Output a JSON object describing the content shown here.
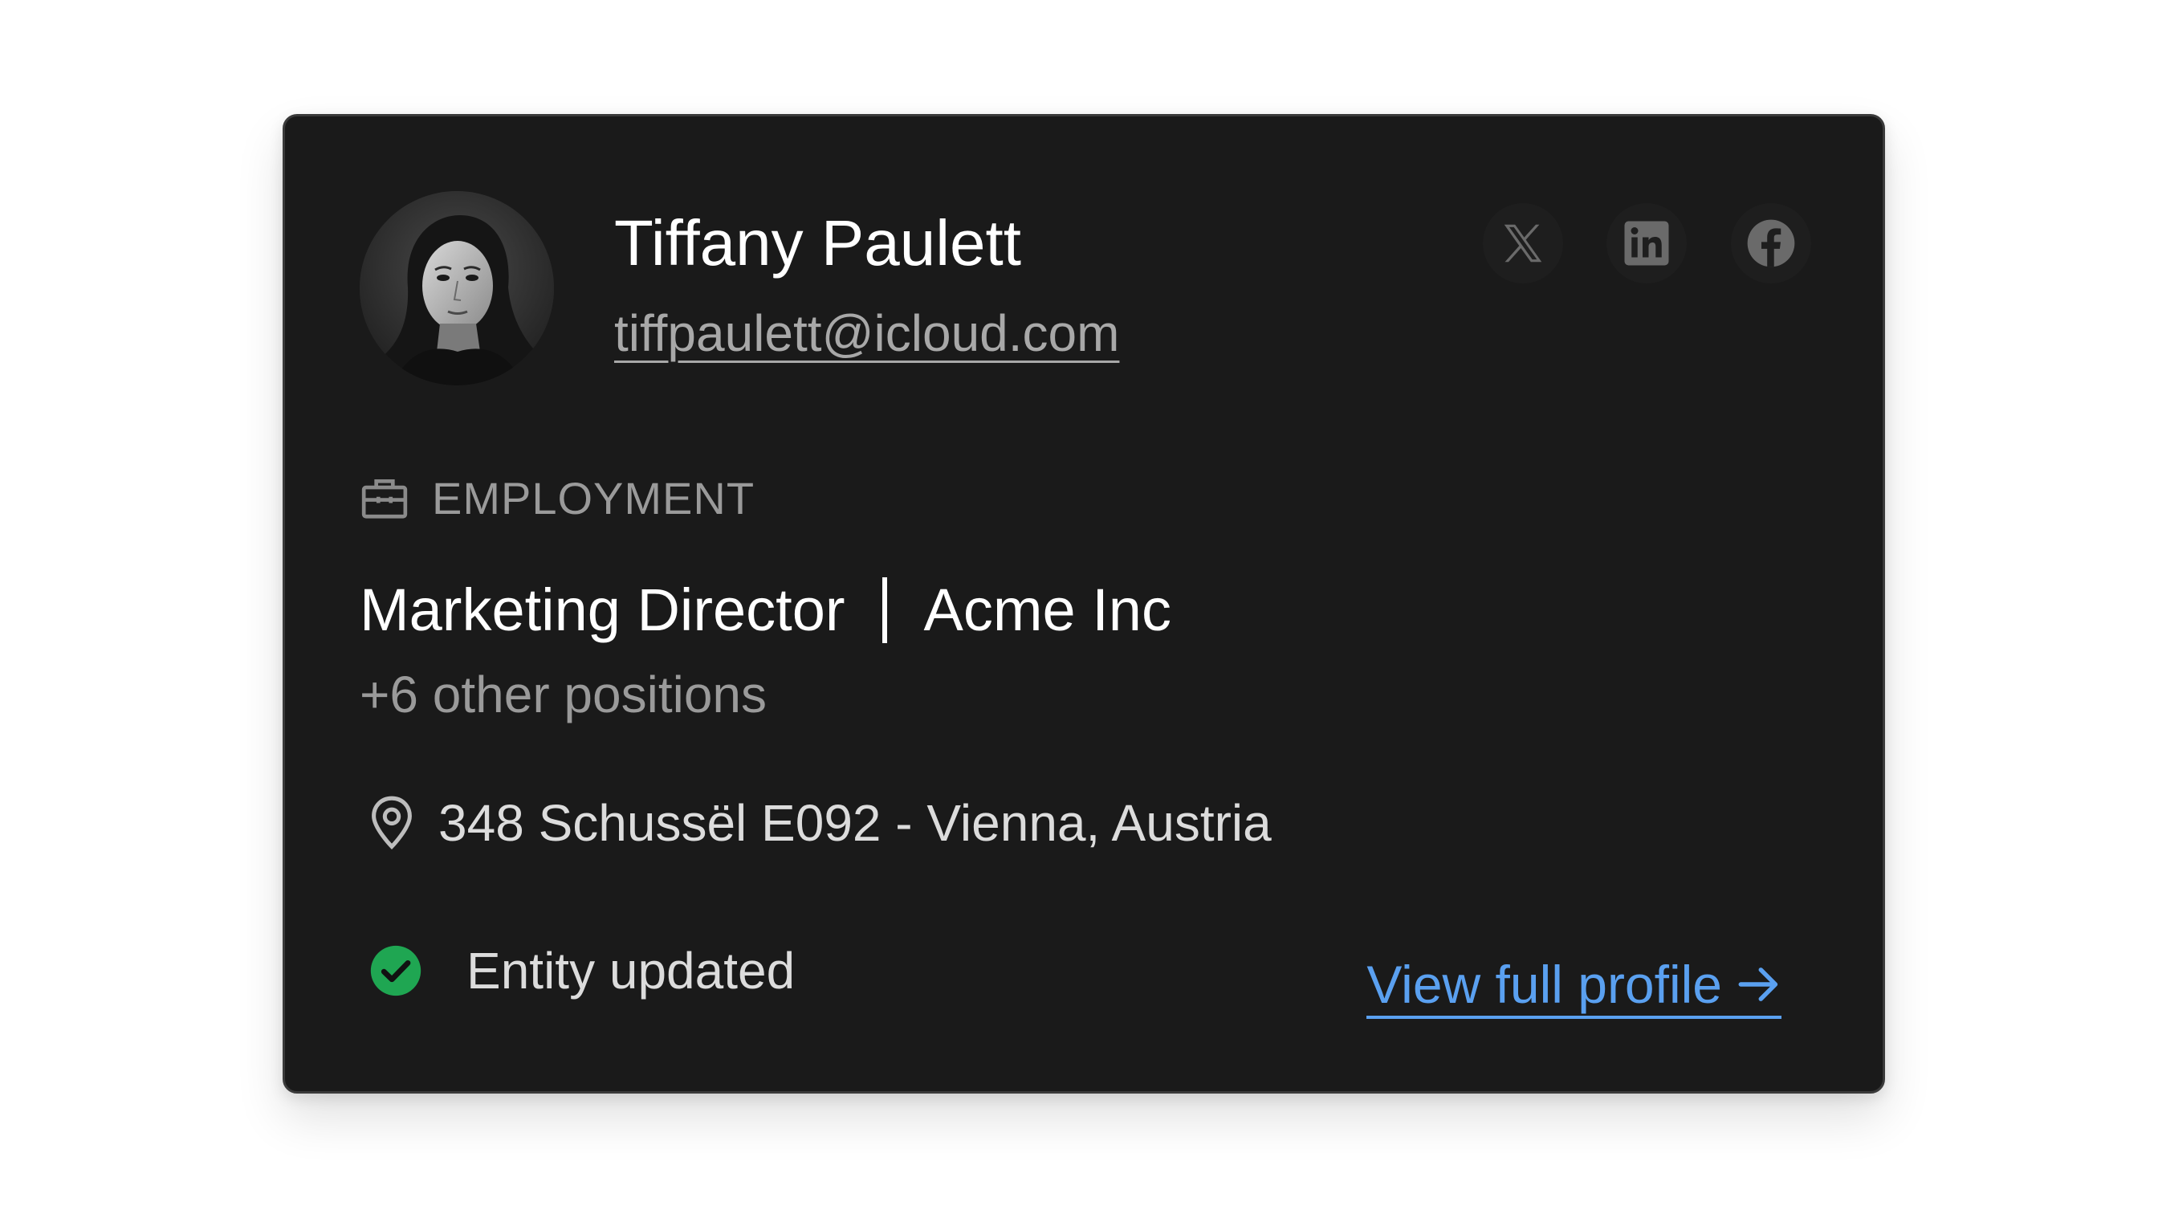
{
  "contact": {
    "name": "Tiffany Paulett",
    "email": "tiffpaulett@icloud.com"
  },
  "social": [
    {
      "icon": "x-icon",
      "label": "X"
    },
    {
      "icon": "linkedin-icon",
      "label": "LinkedIn"
    },
    {
      "icon": "facebook-icon",
      "label": "Facebook"
    }
  ],
  "employment": {
    "section_label": "EMPLOYMENT",
    "title": "Marketing Director",
    "company": "Acme Inc",
    "other_positions": "+6 other positions"
  },
  "location": {
    "address": "348 Schussël E092 - Vienna, Austria"
  },
  "status": {
    "text": "Entity updated",
    "color": "#1fa652"
  },
  "actions": {
    "view_profile": "View full profile",
    "link_color": "#5aa0f0"
  },
  "theme": {
    "card_bg": "#1a1a1a",
    "page_bg": "#ffffff"
  }
}
